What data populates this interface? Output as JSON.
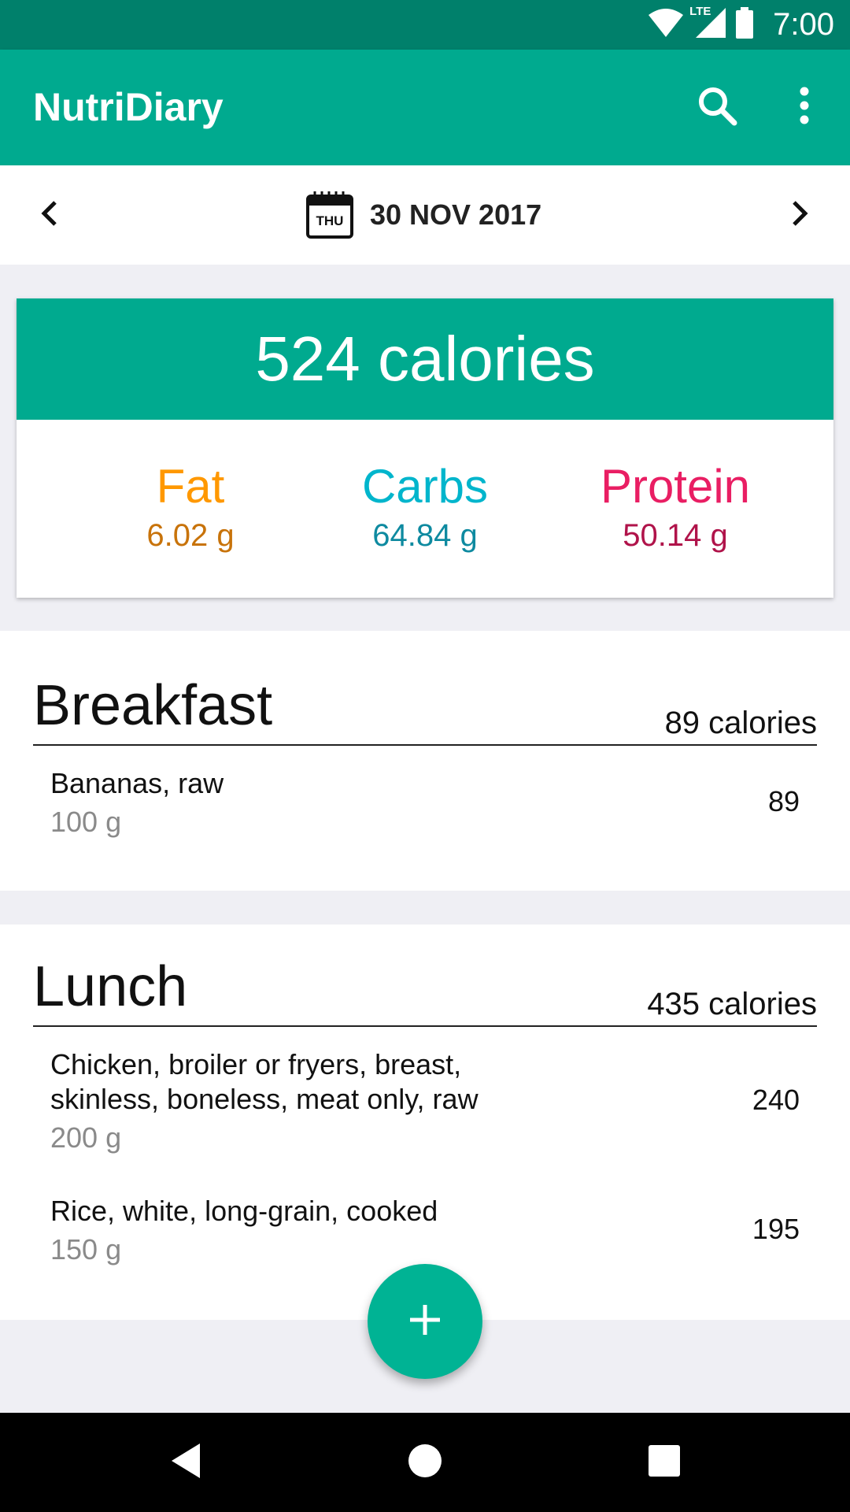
{
  "status_bar": {
    "time": "7:00",
    "network": "LTE"
  },
  "app_bar": {
    "title": "NutriDiary",
    "search_icon": "search-icon",
    "menu_icon": "more-vert-icon"
  },
  "date_bar": {
    "day_abbr": "THU",
    "date": "30 NOV 2017"
  },
  "summary": {
    "calories": "524 calories",
    "macros": [
      {
        "label": "Fat",
        "value": "6.02 g",
        "label_color": "#ff9800",
        "value_color": "#c8730a"
      },
      {
        "label": "Carbs",
        "value": "64.84 g",
        "label_color": "#00b5cc",
        "value_color": "#0e8aa0"
      },
      {
        "label": "Protein",
        "value": "50.14 g",
        "label_color": "#e91e63",
        "value_color": "#b0134a"
      }
    ]
  },
  "meals": [
    {
      "title": "Breakfast",
      "calories": "89 calories",
      "items": [
        {
          "name": "Bananas, raw",
          "qty": "100 g",
          "calories": "89"
        }
      ]
    },
    {
      "title": "Lunch",
      "calories": "435 calories",
      "items": [
        {
          "name": "Chicken, broiler or fryers, breast, skinless, boneless, meat only, raw",
          "qty": "200 g",
          "calories": "240"
        },
        {
          "name": "Rice, white, long-grain, cooked",
          "qty": "150 g",
          "calories": "195"
        }
      ]
    }
  ],
  "colors": {
    "primary": "#00aa8f",
    "primary_dark": "#00806b",
    "fab": "#00b394"
  }
}
